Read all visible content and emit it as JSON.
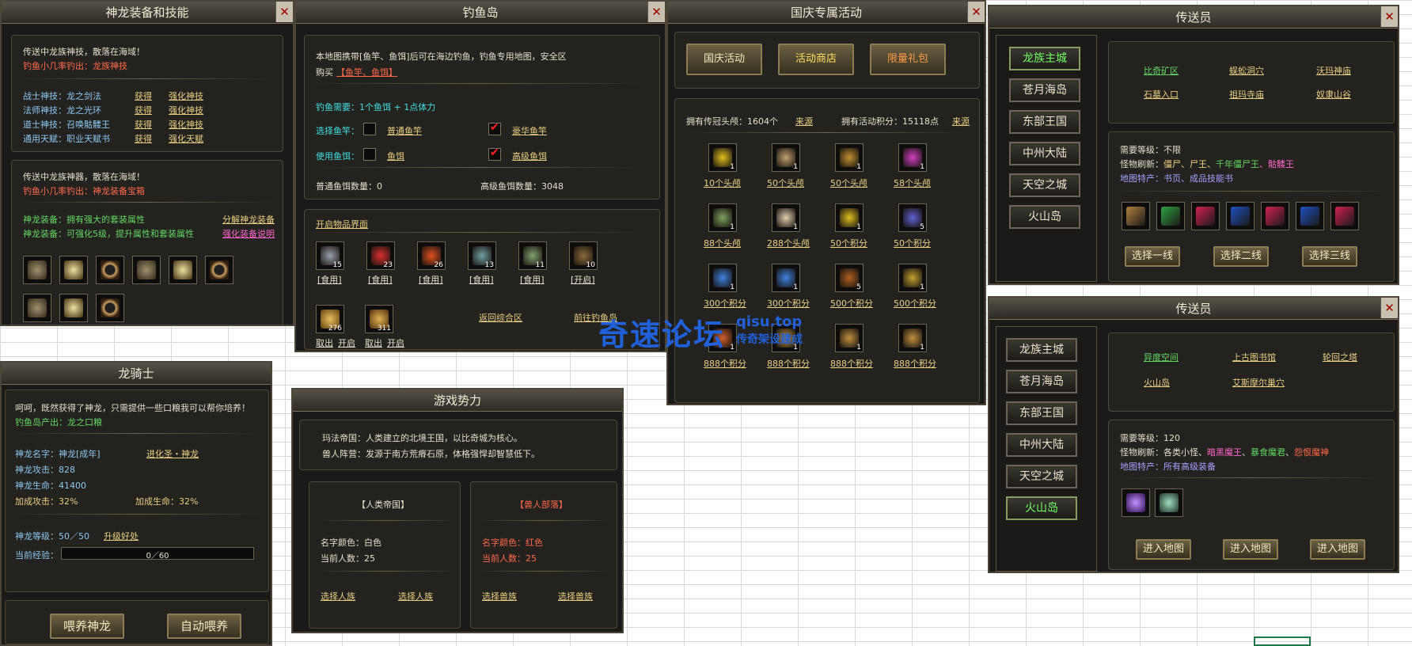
{
  "win1": {
    "title": "神龙装备和技能",
    "p1_line1": "传送中龙族神技，散落在海域！",
    "p1_line2": "钓鱼小几率钓出：龙族神技",
    "skills": [
      {
        "name": "战士神技：龙之剑法",
        "get": "获得",
        "up": "强化神技"
      },
      {
        "name": "法师神技：龙之光环",
        "get": "获得",
        "up": "强化神技"
      },
      {
        "name": "道士神技：召唤骷髅王",
        "get": "获得",
        "up": "强化神技"
      },
      {
        "name": "通用天赋：职业天赋书",
        "get": "获得",
        "up": "强化天赋"
      }
    ],
    "p2_line1": "传送中龙族神器，散落在海域！",
    "p2_line2": "钓鱼小几率钓出：神龙装备宝箱",
    "eq1": "神龙装备：拥有强大的套装属性",
    "eq1_link": "分解神龙装备",
    "eq2": "神龙装备：可强化5级，提升属性和套装属性",
    "eq2_link": "强化装备说明"
  },
  "win2": {
    "title": "钓鱼岛",
    "line1": "本地图携带[鱼竿、鱼饵]后可在海边钓鱼，钓鱼专用地图，安全区",
    "buy_prefix": "购买",
    "buy_items": "【鱼竿、鱼饵】",
    "need": "钓鱼需要：1个鱼饵 + 1点体力",
    "rod_label": "选择鱼竿：",
    "rod1": "普通鱼竿",
    "rod2": "豪华鱼竿",
    "bait_label": "使用鱼饵：",
    "bait1": "鱼饵",
    "bait2": "高级鱼饵",
    "count1": "普通鱼饵数量：0",
    "count2": "高级鱼饵数量：3048",
    "open_ui": "开启物品界面",
    "items": [
      {
        "n": "15",
        "act": "[食用]",
        "c": "#9aa0aa"
      },
      {
        "n": "23",
        "act": "[食用]",
        "c": "#d83030"
      },
      {
        "n": "26",
        "act": "[食用]",
        "c": "#e05020"
      },
      {
        "n": "13",
        "act": "[食用]",
        "c": "#70a0a0"
      },
      {
        "n": "11",
        "act": "[食用]",
        "c": "#80a070"
      },
      {
        "n": "10",
        "act": "[开启]",
        "c": "#8a6a3a"
      }
    ],
    "items2": [
      {
        "n": "276",
        "c": "#c8a040"
      },
      {
        "n": "311",
        "c": "#c09040"
      }
    ],
    "take": "取出",
    "open": "开启",
    "back": "返回综合区",
    "forward": "前往钓鱼岛"
  },
  "win3": {
    "title": "国庆专属活动",
    "tabs": [
      "国庆活动",
      "活动商店",
      "限量礼包"
    ],
    "own1": "拥有传冠头颅：1604个",
    "own2": "拥有活动积分：15118点",
    "source": "来源",
    "shop": [
      {
        "label": "10个头颅",
        "n": "1",
        "c": "#e0c020"
      },
      {
        "label": "50个头颅",
        "n": "1",
        "c": "#c0a070"
      },
      {
        "label": "50个头颅",
        "n": "1",
        "c": "#c09030"
      },
      {
        "label": "58个头颅",
        "n": "1",
        "c": "#d040c0"
      },
      {
        "label": "88个头颅",
        "n": "1",
        "c": "#80a060"
      },
      {
        "label": "288个头颅",
        "n": "1",
        "c": "#e0d0b0"
      },
      {
        "label": "50个积分",
        "n": "1",
        "c": "#e0c020"
      },
      {
        "label": "50个积分",
        "n": "5",
        "c": "#6060d0"
      },
      {
        "label": "300个积分",
        "n": "1",
        "c": "#4080e0"
      },
      {
        "label": "300个积分",
        "n": "1",
        "c": "#4080e0"
      },
      {
        "label": "500个积分",
        "n": "5",
        "c": "#b06020"
      },
      {
        "label": "500个积分",
        "n": "1",
        "c": "#c0a030"
      },
      {
        "label": "888个积分",
        "n": "1",
        "c": "#d06030"
      },
      {
        "label": "888个积分",
        "n": "1",
        "c": "#c09040"
      },
      {
        "label": "888个积分",
        "n": "1",
        "c": "#c09040"
      },
      {
        "label": "888个积分",
        "n": "1",
        "c": "#c09040"
      }
    ]
  },
  "watermark": {
    "main": "奇速论坛",
    "url": "qisu.top",
    "sub": "传奇架设建成"
  },
  "win4": {
    "title": "传送员",
    "nav": [
      "龙族主城",
      "苍月海岛",
      "东部王国",
      "中州大陆",
      "天空之城",
      "火山岛"
    ],
    "maps_green": [
      "比奇矿区"
    ],
    "maps": [
      "蜈蚣洞穴",
      "沃玛神庙",
      "石墓入口",
      "祖玛寺庙",
      "奴隶山谷"
    ],
    "level": "需要等级：不限",
    "mon_prefix": "怪物刷新：",
    "mon1": "僵尸、尸王、",
    "mon2": "千年僵尸王",
    "mon3": "、骷髅王",
    "feat": "地图特产：书页、成品技能书",
    "books": [
      "#b08040",
      "#30a040",
      "#d02050",
      "#2050c0",
      "#d02050",
      "#2050c0",
      "#d02050"
    ],
    "btns": [
      "选择一线",
      "选择二线",
      "选择三线"
    ]
  },
  "win5": {
    "title": "传送员",
    "nav": [
      "龙族主城",
      "苍月海岛",
      "东部王国",
      "中州大陆",
      "天空之城",
      "火山岛"
    ],
    "maps": [
      "异度空间",
      "上古图书馆",
      "轮回之塔",
      "火山岛",
      "艾斯摩尔巢穴"
    ],
    "level": "需要等级：120",
    "mon_prefix": "怪物刷新：各类小怪、",
    "mon1": "暗黑魔王",
    "mon2": "暴食魔君",
    "mon3": "怨恨魔神",
    "sep": "、",
    "feat": "地图特产：所有高级装备",
    "btns": [
      "进入地图",
      "进入地图",
      "进入地图"
    ]
  },
  "win6": {
    "title": "龙骑士",
    "line1": "呵呵，既然获得了神龙，只需提供一些口粮我可以帮你培养！",
    "line2": "钓鱼岛产出：龙之口粮",
    "name": "神龙名字：神龙[成年]",
    "evolve": "进化圣・神龙",
    "atk": "神龙攻击：828",
    "hp": "神龙生命：41400",
    "bonus_atk": "加成攻击：32%",
    "bonus_hp": "加成生命：32%",
    "level": "神龙等级：50／50",
    "upgrade": "升级好处",
    "exp_label": "当前经验：",
    "exp": "0／60",
    "exp_ratio": 0,
    "feed": "喂养神龙",
    "auto": "自动喂养"
  },
  "win7": {
    "title": "游戏势力",
    "line1": "玛法帝国：人类建立的北境王国，以比奇城为核心。",
    "line2": "兽人阵营：发源于南方荒瘠石原，体格强悍却智慧低下。",
    "human": {
      "head": "【人类帝国】",
      "color": "名字颜色：白色",
      "count": "当前人数：25",
      "b1": "选择人族",
      "b2": "选择人族"
    },
    "orc": {
      "head": "【兽人部落】",
      "color": "名字颜色：红色",
      "count": "当前人数：25",
      "b1": "选择兽族",
      "b2": "选择兽族"
    }
  }
}
